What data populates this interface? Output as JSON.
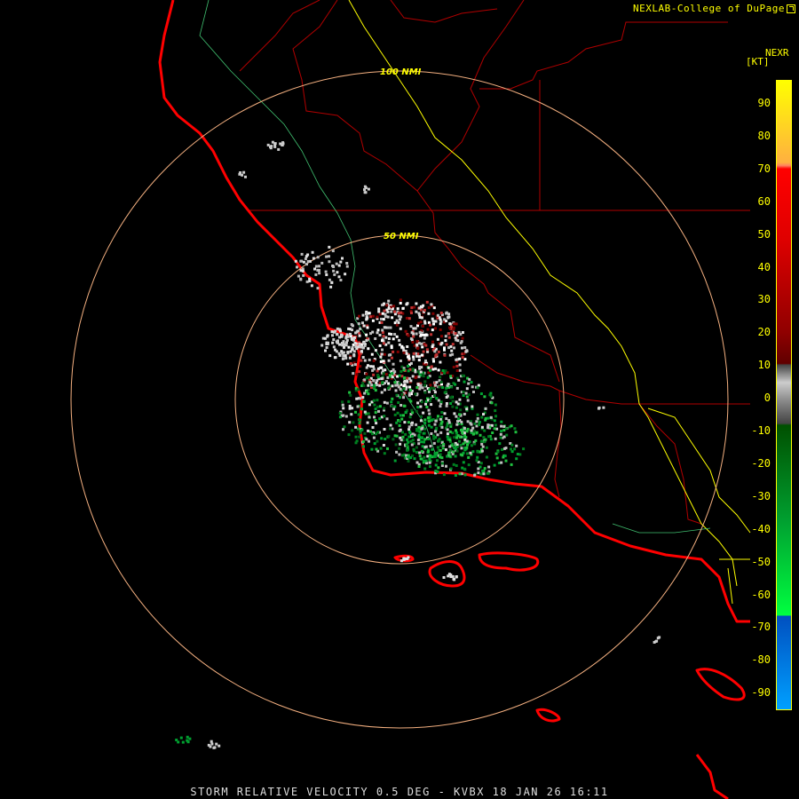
{
  "credit": "NEXLAB-College of DuPage",
  "product": "NEXR",
  "unit": "[KT]",
  "caption": "STORM RELATIVE VELOCITY 0.5 DEG - KVBX 18 JAN 26 16:11",
  "rings": [
    {
      "label": "100 NMI"
    },
    {
      "label": "50 NMI"
    }
  ],
  "legend_ticks": [
    "90",
    "80",
    "70",
    "60",
    "50",
    "40",
    "30",
    "20",
    "10",
    "0",
    "-10",
    "-20",
    "-30",
    "-40",
    "-50",
    "-60",
    "-70",
    "-80",
    "-90"
  ],
  "colors": {
    "coastline": "#ff0000",
    "county_lines": "#b00000",
    "highways": "#ffff00",
    "rivers": "#40c070",
    "range_rings": "#f4b080",
    "text": "#ffff00"
  },
  "icons": {
    "credit": "external-link-icon"
  }
}
